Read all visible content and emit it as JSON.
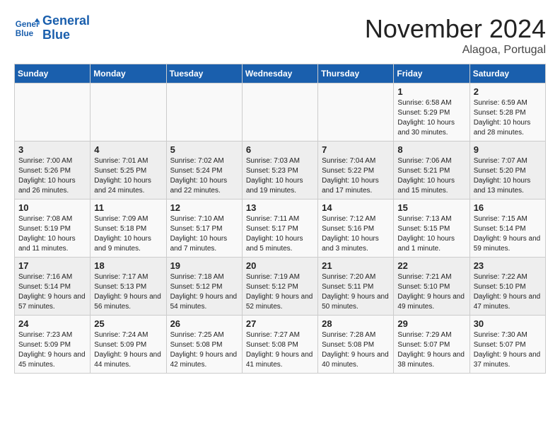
{
  "logo": {
    "line1": "General",
    "line2": "Blue"
  },
  "title": "November 2024",
  "subtitle": "Alagoa, Portugal",
  "headers": [
    "Sunday",
    "Monday",
    "Tuesday",
    "Wednesday",
    "Thursday",
    "Friday",
    "Saturday"
  ],
  "weeks": [
    [
      {
        "day": "",
        "info": ""
      },
      {
        "day": "",
        "info": ""
      },
      {
        "day": "",
        "info": ""
      },
      {
        "day": "",
        "info": ""
      },
      {
        "day": "",
        "info": ""
      },
      {
        "day": "1",
        "info": "Sunrise: 6:58 AM\nSunset: 5:29 PM\nDaylight: 10 hours and 30 minutes."
      },
      {
        "day": "2",
        "info": "Sunrise: 6:59 AM\nSunset: 5:28 PM\nDaylight: 10 hours and 28 minutes."
      }
    ],
    [
      {
        "day": "3",
        "info": "Sunrise: 7:00 AM\nSunset: 5:26 PM\nDaylight: 10 hours and 26 minutes."
      },
      {
        "day": "4",
        "info": "Sunrise: 7:01 AM\nSunset: 5:25 PM\nDaylight: 10 hours and 24 minutes."
      },
      {
        "day": "5",
        "info": "Sunrise: 7:02 AM\nSunset: 5:24 PM\nDaylight: 10 hours and 22 minutes."
      },
      {
        "day": "6",
        "info": "Sunrise: 7:03 AM\nSunset: 5:23 PM\nDaylight: 10 hours and 19 minutes."
      },
      {
        "day": "7",
        "info": "Sunrise: 7:04 AM\nSunset: 5:22 PM\nDaylight: 10 hours and 17 minutes."
      },
      {
        "day": "8",
        "info": "Sunrise: 7:06 AM\nSunset: 5:21 PM\nDaylight: 10 hours and 15 minutes."
      },
      {
        "day": "9",
        "info": "Sunrise: 7:07 AM\nSunset: 5:20 PM\nDaylight: 10 hours and 13 minutes."
      }
    ],
    [
      {
        "day": "10",
        "info": "Sunrise: 7:08 AM\nSunset: 5:19 PM\nDaylight: 10 hours and 11 minutes."
      },
      {
        "day": "11",
        "info": "Sunrise: 7:09 AM\nSunset: 5:18 PM\nDaylight: 10 hours and 9 minutes."
      },
      {
        "day": "12",
        "info": "Sunrise: 7:10 AM\nSunset: 5:17 PM\nDaylight: 10 hours and 7 minutes."
      },
      {
        "day": "13",
        "info": "Sunrise: 7:11 AM\nSunset: 5:17 PM\nDaylight: 10 hours and 5 minutes."
      },
      {
        "day": "14",
        "info": "Sunrise: 7:12 AM\nSunset: 5:16 PM\nDaylight: 10 hours and 3 minutes."
      },
      {
        "day": "15",
        "info": "Sunrise: 7:13 AM\nSunset: 5:15 PM\nDaylight: 10 hours and 1 minute."
      },
      {
        "day": "16",
        "info": "Sunrise: 7:15 AM\nSunset: 5:14 PM\nDaylight: 9 hours and 59 minutes."
      }
    ],
    [
      {
        "day": "17",
        "info": "Sunrise: 7:16 AM\nSunset: 5:14 PM\nDaylight: 9 hours and 57 minutes."
      },
      {
        "day": "18",
        "info": "Sunrise: 7:17 AM\nSunset: 5:13 PM\nDaylight: 9 hours and 56 minutes."
      },
      {
        "day": "19",
        "info": "Sunrise: 7:18 AM\nSunset: 5:12 PM\nDaylight: 9 hours and 54 minutes."
      },
      {
        "day": "20",
        "info": "Sunrise: 7:19 AM\nSunset: 5:12 PM\nDaylight: 9 hours and 52 minutes."
      },
      {
        "day": "21",
        "info": "Sunrise: 7:20 AM\nSunset: 5:11 PM\nDaylight: 9 hours and 50 minutes."
      },
      {
        "day": "22",
        "info": "Sunrise: 7:21 AM\nSunset: 5:10 PM\nDaylight: 9 hours and 49 minutes."
      },
      {
        "day": "23",
        "info": "Sunrise: 7:22 AM\nSunset: 5:10 PM\nDaylight: 9 hours and 47 minutes."
      }
    ],
    [
      {
        "day": "24",
        "info": "Sunrise: 7:23 AM\nSunset: 5:09 PM\nDaylight: 9 hours and 45 minutes."
      },
      {
        "day": "25",
        "info": "Sunrise: 7:24 AM\nSunset: 5:09 PM\nDaylight: 9 hours and 44 minutes."
      },
      {
        "day": "26",
        "info": "Sunrise: 7:25 AM\nSunset: 5:08 PM\nDaylight: 9 hours and 42 minutes."
      },
      {
        "day": "27",
        "info": "Sunrise: 7:27 AM\nSunset: 5:08 PM\nDaylight: 9 hours and 41 minutes."
      },
      {
        "day": "28",
        "info": "Sunrise: 7:28 AM\nSunset: 5:08 PM\nDaylight: 9 hours and 40 minutes."
      },
      {
        "day": "29",
        "info": "Sunrise: 7:29 AM\nSunset: 5:07 PM\nDaylight: 9 hours and 38 minutes."
      },
      {
        "day": "30",
        "info": "Sunrise: 7:30 AM\nSunset: 5:07 PM\nDaylight: 9 hours and 37 minutes."
      }
    ]
  ]
}
